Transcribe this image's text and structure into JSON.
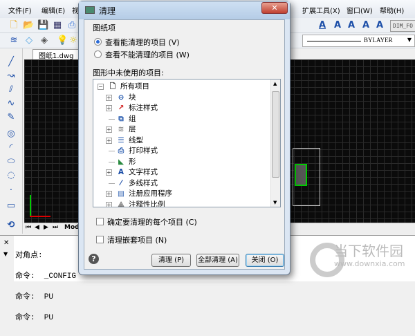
{
  "menubar": {
    "items": [
      "文件(F)",
      "编辑(E)",
      "视",
      "扩展工具(X)",
      "窗口(W)",
      "帮助(H)"
    ]
  },
  "toolbar": {
    "dimstyle": "DIM_FO",
    "linetype": "BYLAYER"
  },
  "document_tab": "图纸1.dwg",
  "layout_tab": "Mod",
  "command": {
    "lines": [
      "对角点:",
      "命令:  _CONFIG",
      "命令:  PU",
      "命令:  PU"
    ]
  },
  "dialog": {
    "title": "清理",
    "group_label": "图纸项",
    "radio_purgeable": "查看能清理的项目 (V)",
    "radio_nonpurgeable": "查看不能清理的项目 (W)",
    "unused_label": "图形中未使用的项目:",
    "tree": [
      {
        "label": "所有项目",
        "expand": "-"
      },
      {
        "label": "块",
        "expand": "+",
        "icon": "block-icon"
      },
      {
        "label": "标注样式",
        "expand": "+",
        "icon": "dimstyle-icon"
      },
      {
        "label": "组",
        "expand": "",
        "icon": "group-icon"
      },
      {
        "label": "层",
        "expand": "+",
        "icon": "layer-icon"
      },
      {
        "label": "线型",
        "expand": "+",
        "icon": "linetype-icon"
      },
      {
        "label": "打印样式",
        "expand": "",
        "icon": "plotstyle-icon"
      },
      {
        "label": "形",
        "expand": "",
        "icon": "shape-icon"
      },
      {
        "label": "文字样式",
        "expand": "+",
        "icon": "textstyle-icon"
      },
      {
        "label": "多线样式",
        "expand": "",
        "icon": "mlinestyle-icon"
      },
      {
        "label": "注册应用程序",
        "expand": "+",
        "icon": "regapp-icon"
      },
      {
        "label": "注释性比例",
        "expand": "+",
        "icon": "annoscale-icon"
      }
    ],
    "confirm_each": "确定要清理的每个项目 (C)",
    "purge_nested": "清理嵌套项目 (N)",
    "btn_purge": "清理 (P)",
    "btn_purge_all": "全部清理 (A)",
    "btn_close": "关闭 (O)"
  },
  "watermark": {
    "name": "当下软件园",
    "url": "www.downxia.com"
  }
}
